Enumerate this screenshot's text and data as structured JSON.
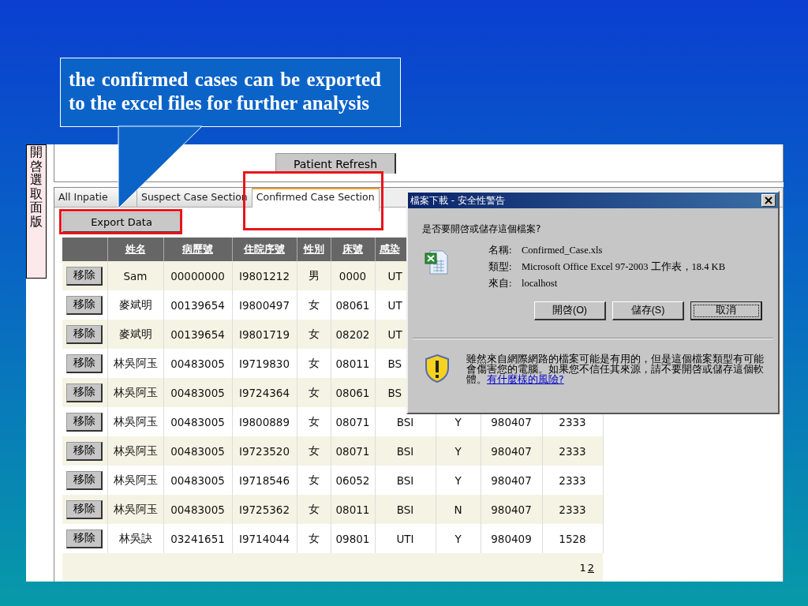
{
  "side_label": "開啓選取面版",
  "refresh_button": "Patient Refresh",
  "tabs": [
    {
      "label": "All Inpatie",
      "selected": false,
      "highlighted": false
    },
    {
      "label": "Suspect Case Section",
      "selected": false,
      "highlighted": false
    },
    {
      "label": "Confirmed Case Section",
      "selected": true,
      "highlighted": true
    }
  ],
  "export_button": {
    "label": "Export Data",
    "highlighted": true
  },
  "table": {
    "columns": [
      "姓名",
      "病歷號",
      "住院序號",
      "性別",
      "床號",
      "感染"
    ],
    "rows": [
      {
        "action": "移除",
        "cells": [
          "Sam",
          "00000000",
          "I9801212",
          "男",
          "0000",
          "UT"
        ]
      },
      {
        "action": "移除",
        "cells": [
          "麥斌明",
          "00139654",
          "I9800497",
          "女",
          "08061",
          "UT"
        ]
      },
      {
        "action": "移除",
        "cells": [
          "麥斌明",
          "00139654",
          "I9801719",
          "女",
          "08202",
          "UT"
        ]
      },
      {
        "action": "移除",
        "cells": [
          "林吳阿玉",
          "00483005",
          "I9719830",
          "女",
          "08011",
          "BS"
        ]
      },
      {
        "action": "移除",
        "cells": [
          "林吳阿玉",
          "00483005",
          "I9724364",
          "女",
          "08061",
          "BS"
        ]
      },
      {
        "action": "移除",
        "cells": [
          "林吳阿玉",
          "00483005",
          "I9800889",
          "女",
          "08071",
          "BSI",
          "Y",
          "980407",
          "2333"
        ]
      },
      {
        "action": "移除",
        "cells": [
          "林吳阿玉",
          "00483005",
          "I9723520",
          "女",
          "08071",
          "BSI",
          "Y",
          "980407",
          "2333"
        ]
      },
      {
        "action": "移除",
        "cells": [
          "林吳阿玉",
          "00483005",
          "I9718546",
          "女",
          "06052",
          "BSI",
          "Y",
          "980407",
          "2333"
        ]
      },
      {
        "action": "移除",
        "cells": [
          "林吳阿玉",
          "00483005",
          "I9725362",
          "女",
          "08011",
          "BSI",
          "N",
          "980407",
          "2333"
        ]
      },
      {
        "action": "移除",
        "cells": [
          "林吳訣",
          "03241651",
          "I9714044",
          "女",
          "09801",
          "UTI",
          "Y",
          "980409",
          "1528"
        ]
      }
    ]
  },
  "pagination": [
    {
      "label": "1",
      "selected": true
    },
    {
      "label": "2",
      "selected": false
    }
  ],
  "callout": "the confirmed cases can be exported to the excel files for further analysis",
  "dialog": {
    "title": "檔案下載 - 安全性警告",
    "question": "是否要開啓或儲存這個檔案?",
    "fields": [
      {
        "label": "名稱:",
        "value": "Confirmed_Case.xls"
      },
      {
        "label": "類型:",
        "value": "Microsoft Office Excel 97-2003 工作表，18.4 KB"
      },
      {
        "label": "來自:",
        "value": "localhost"
      }
    ],
    "buttons": [
      {
        "label": "開啓(O)",
        "focused": false
      },
      {
        "label": "儲存(S)",
        "focused": false
      },
      {
        "label": "取消",
        "focused": true
      }
    ],
    "warning": "雖然來自網際網路的檔案可能是有用的，但是這個檔案類型有可能會傷害您的電腦。如果您不信任其來源，請不要開啓或儲存這個軟體。",
    "warning_link": "有什麼樣的風險?"
  }
}
